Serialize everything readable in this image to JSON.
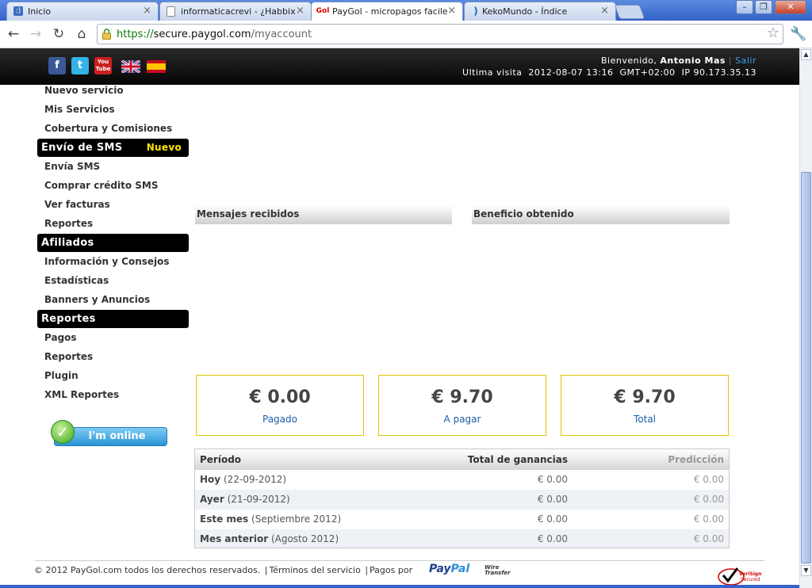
{
  "browser": {
    "tabs": [
      {
        "label": "Inicio",
        "favicon": ":)",
        "active": false
      },
      {
        "label": "informaticacrevi - ¿Habbixier?",
        "favicon": "doc",
        "active": false
      },
      {
        "label": "PayGol - micropagos faciles",
        "favicon": "Gol",
        "active": true
      },
      {
        "label": "KekoMundo - Índice",
        "favicon": ")",
        "active": false
      }
    ],
    "url_scheme": "https://",
    "url_domain": "secure.paygol.com",
    "url_path": "/myaccount"
  },
  "header": {
    "welcome_prefix": "Bienvenido,",
    "user_name": "Antonio Mas",
    "logout": "Salir",
    "last_visit": "Ultima visita  2012-08-07 13:16  GMT+02:00  IP 90.173.35.13",
    "social": {
      "facebook": "f",
      "twitter": "t",
      "youtube": "You Tube"
    }
  },
  "sidebar": {
    "links_top": [
      "Nuevo servicio",
      "Mis Servicios",
      "Cobertura y Comisiones"
    ],
    "section_sms": {
      "title": "Envío de SMS",
      "badge": "Nuevo"
    },
    "links_sms": [
      "Envía SMS",
      "Comprar crédito SMS",
      "Ver facturas",
      "Reportes"
    ],
    "section_affiliates": {
      "title": "Afiliados"
    },
    "links_affiliates": [
      "Información y Consejos",
      "Estadísticas",
      "Banners y Anuncios"
    ],
    "section_reports": {
      "title": "Reportes"
    },
    "links_reports": [
      "Pagos",
      "Reportes",
      "Plugin",
      "XML Reportes"
    ],
    "online_label": "I'm online"
  },
  "panels": {
    "received": "Mensajes recibidos",
    "profit": "Beneficio obtenido"
  },
  "stats": [
    {
      "value": "€ 0.00",
      "label": "Pagado"
    },
    {
      "value": "€ 9.70",
      "label": "A pagar"
    },
    {
      "value": "€ 9.70",
      "label": "Total"
    }
  ],
  "earnings": {
    "headers": {
      "period": "Período",
      "total": "Total de ganancias",
      "prediction": "Predicción"
    },
    "rows": [
      {
        "name": "Hoy",
        "detail": "(22-09-2012)",
        "total": "€ 0.00",
        "prediction": "€ 0.00"
      },
      {
        "name": "Ayer",
        "detail": "(21-09-2012)",
        "total": "€ 0.00",
        "prediction": "€ 0.00"
      },
      {
        "name": "Este mes",
        "detail": "(Septiembre 2012)",
        "total": "€ 0.00",
        "prediction": "€ 0.00"
      },
      {
        "name": "Mes anterior",
        "detail": "(Agosto 2012)",
        "total": "€ 0.00",
        "prediction": "€ 0.00"
      }
    ]
  },
  "footer": {
    "copyright": "© 2012 PayGol.com todos los derechos reservados.",
    "terms": "Términos del servicio",
    "paid_via": "Pagos por",
    "paypal_a": "Pay",
    "paypal_b": "Pal",
    "wire_a": "Wire",
    "wire_b": "Transfer",
    "verisign_a": "VeriSign",
    "verisign_b": "Secured"
  },
  "colors": {
    "accent_link": "#1a5ea8",
    "badge": "#ffe600",
    "stat_border": "#e3c400",
    "logout": "#3aa0e8"
  }
}
